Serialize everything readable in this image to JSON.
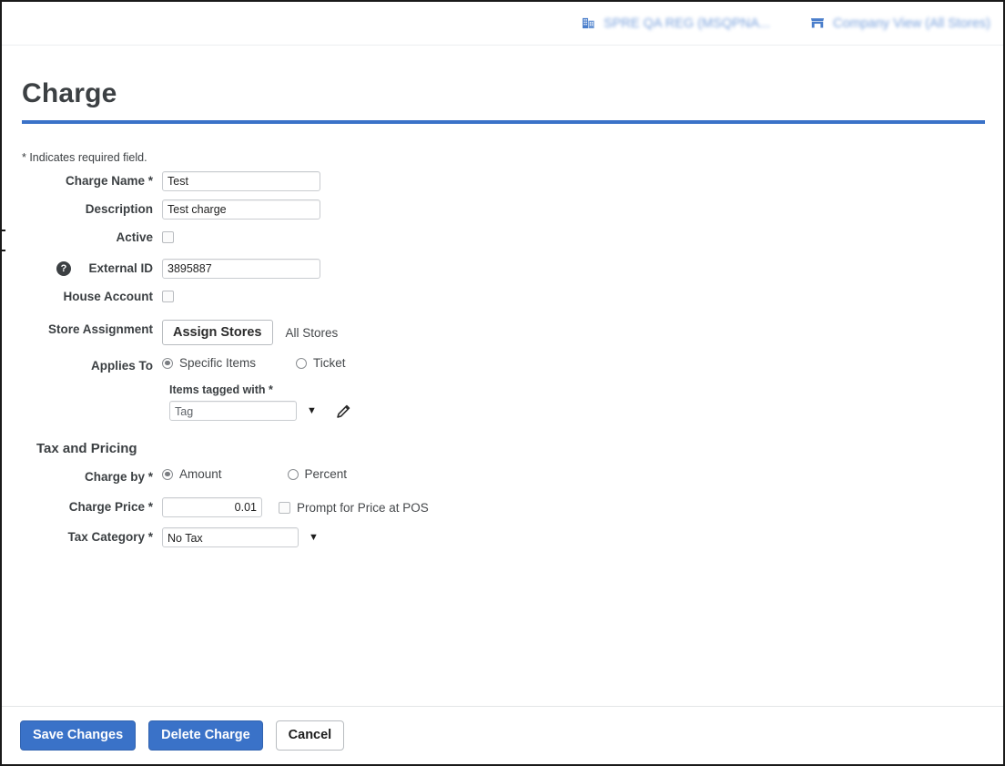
{
  "topbar": {
    "items": [
      {
        "icon": "building-icon",
        "label": "SPRE QA REG (MSQPNA..."
      },
      {
        "icon": "storefront-icon",
        "label": "Company View (All Stores)"
      }
    ]
  },
  "page": {
    "title": "Charge",
    "required_note": "* Indicates required field.",
    "accent_color": "#3a72c8"
  },
  "form": {
    "charge_name": {
      "label": "Charge Name *",
      "value": "Test",
      "placeholder": ""
    },
    "description": {
      "label": "Description",
      "value": "Test charge",
      "placeholder": ""
    },
    "active": {
      "label": "Active",
      "checked": false
    },
    "external_id": {
      "label": "External ID",
      "value": "3895887",
      "help_icon": "help-circle-icon"
    },
    "house_account": {
      "label": "House Account",
      "checked": false
    },
    "store_assignment": {
      "label": "Store Assignment",
      "button_label": "Assign Stores",
      "status": "All Stores"
    },
    "applies_to": {
      "label": "Applies To",
      "options": [
        {
          "label": "Specific Items",
          "selected": true
        },
        {
          "label": "Ticket",
          "selected": false
        }
      ]
    },
    "items_tagged_with": {
      "label": "Items tagged with *",
      "value": "Tag",
      "caret": "chevron-down-icon",
      "edit_icon": "pencil-icon"
    }
  },
  "tax_pricing": {
    "section_title": "Tax and Pricing",
    "charge_by": {
      "label": "Charge by *",
      "options": [
        {
          "label": "Amount",
          "selected": true
        },
        {
          "label": "Percent",
          "selected": false
        }
      ]
    },
    "charge_price": {
      "label": "Charge Price *",
      "value": "0.01",
      "prompt_label": "Prompt for Price at POS",
      "prompt_checked": false
    },
    "tax_category": {
      "label": "Tax Category *",
      "value": "No Tax",
      "caret": "chevron-down-icon"
    }
  },
  "footer": {
    "save_label": "Save Changes",
    "delete_label": "Delete Charge",
    "cancel_label": "Cancel"
  }
}
